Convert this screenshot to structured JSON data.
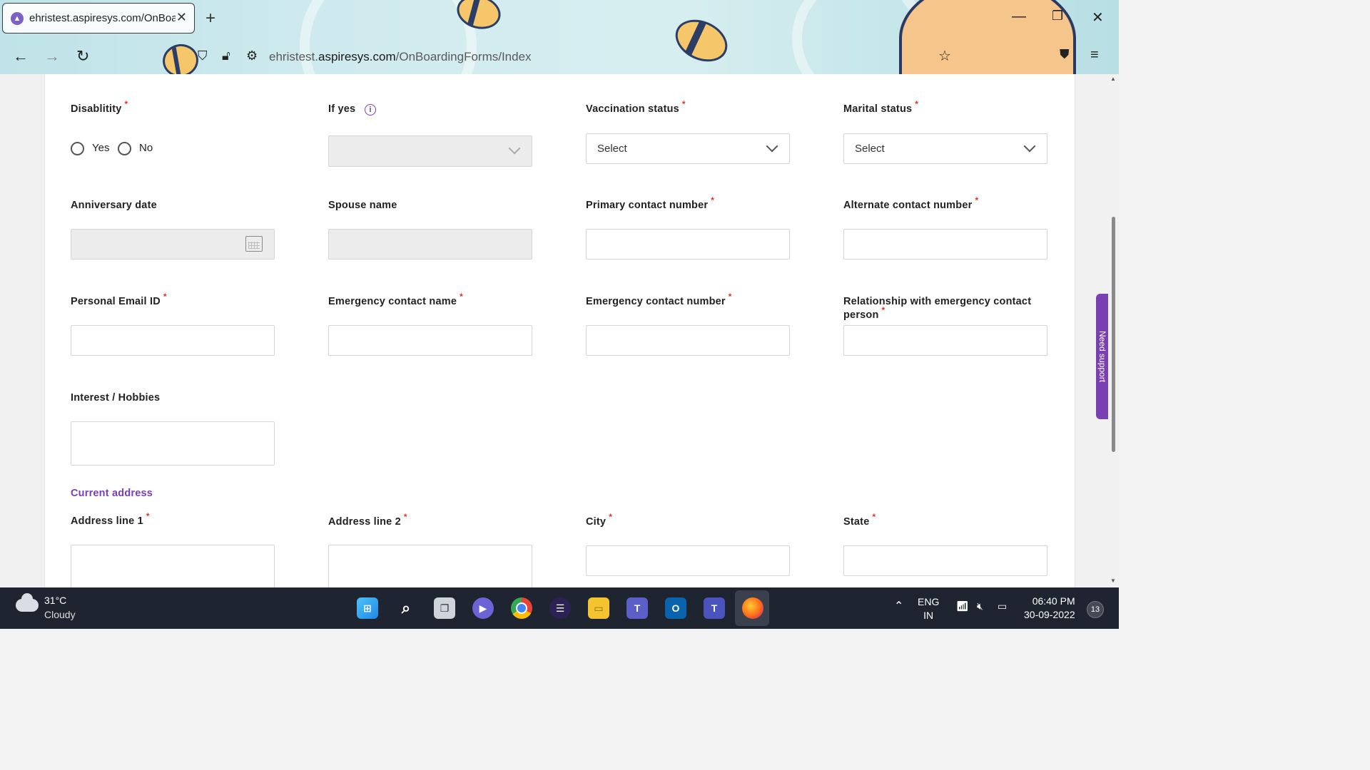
{
  "browser": {
    "tab_title": "ehristest.aspiresys.com/OnBoardingForms/Index",
    "url_domain_prefix": "ehristest.",
    "url_domain": "aspiresys.com",
    "url_path": "/OnBoardingForms/Index"
  },
  "form": {
    "disability": {
      "label": "Disablitity",
      "options": [
        "Yes",
        "No"
      ]
    },
    "if_yes": {
      "label": "If yes"
    },
    "vaccination_status": {
      "label": "Vaccination status",
      "value": "Select"
    },
    "marital_status": {
      "label": "Marital status",
      "value": "Select"
    },
    "anniversary_date": {
      "label": "Anniversary date"
    },
    "spouse_name": {
      "label": "Spouse name"
    },
    "primary_contact": {
      "label": "Primary contact number"
    },
    "alternate_contact": {
      "label": "Alternate contact number"
    },
    "personal_email": {
      "label": "Personal Email ID"
    },
    "emergency_name": {
      "label": "Emergency contact name"
    },
    "emergency_number": {
      "label": "Emergency contact number"
    },
    "relationship": {
      "label_line1": "Relationship with emergency contact",
      "label_line2": "person"
    },
    "interests": {
      "label": "Interest / Hobbies"
    },
    "current_address": {
      "title": "Current address"
    },
    "address_line1": {
      "label": "Address line 1"
    },
    "address_line2": {
      "label": "Address line 2"
    },
    "city": {
      "label": "City"
    },
    "state": {
      "label": "State"
    },
    "required_mark": "*"
  },
  "support_tab": {
    "label": "Need support"
  },
  "taskbar": {
    "weather_temp": "31°C",
    "weather_desc": "Cloudy",
    "lang_top": "ENG",
    "lang_bottom": "IN",
    "time": "06:40 PM",
    "date": "30-09-2022",
    "notification_count": "13"
  },
  "colors": {
    "accent": "#7a3fb3",
    "required": "#e0312b",
    "taskbar": "#1f2530"
  }
}
